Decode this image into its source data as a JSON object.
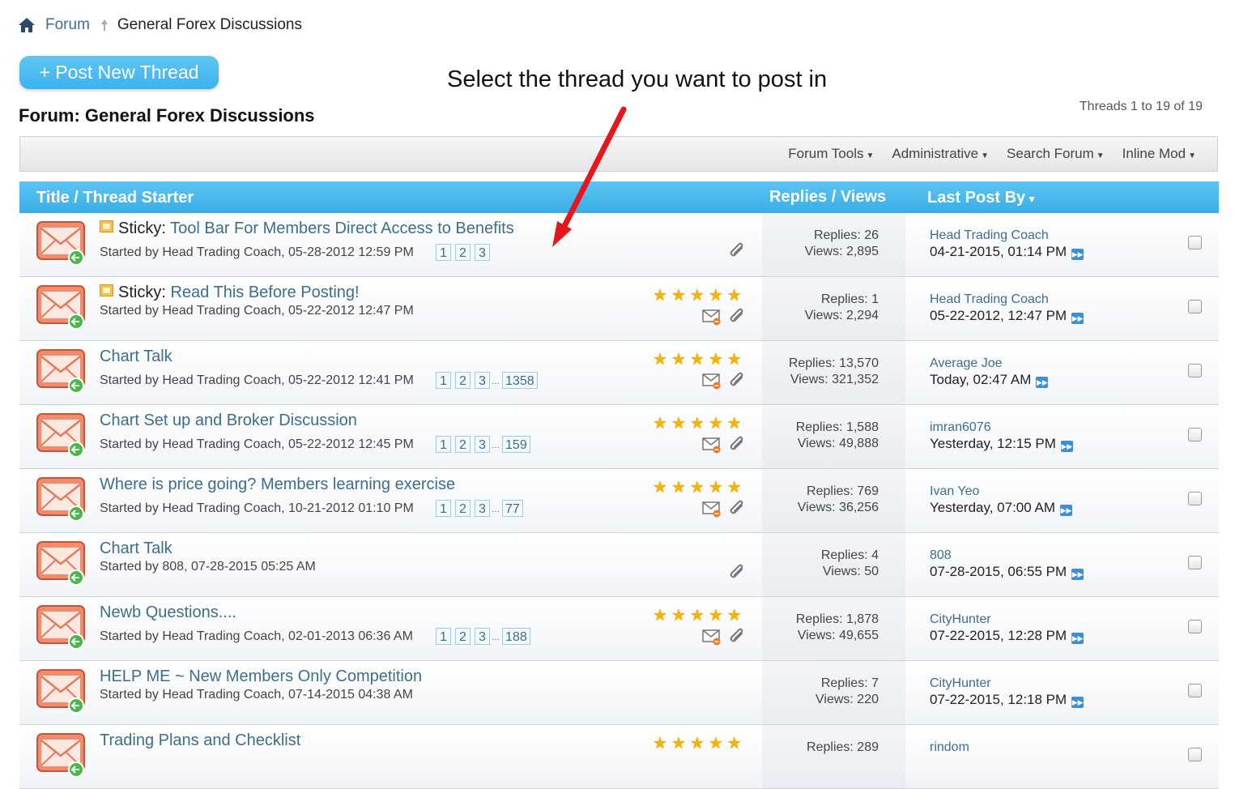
{
  "breadcrumb": {
    "home_icon": "home-icon",
    "forum": "Forum",
    "current": "General Forex Discussions"
  },
  "post_button": {
    "label": "+ Post New Thread"
  },
  "annotation": "Select the thread you want to post in",
  "forum_title": "Forum: General Forex Discussions",
  "thread_count": "Threads 1 to 19 of 19",
  "toolbar": {
    "items": [
      "Forum Tools",
      "Administrative",
      "Search Forum",
      "Inline Mod"
    ]
  },
  "table_header": {
    "title_col": "Title / Thread Starter",
    "stats_col": "Replies / Views",
    "lastpost_col": "Last Post By"
  },
  "colors": {
    "accent": "#3cb2ee",
    "link": "#3e6d8e",
    "star": "#f4b400",
    "arrow": "#e8161b"
  },
  "threads": [
    {
      "prefix": "Sticky:",
      "title": "Tool Bar For Members Direct Access to Benefits",
      "sticky": true,
      "starter": "Started by Head Trading Coach, 05-28-2012 12:59 PM",
      "pages": [
        "1",
        "2",
        "3"
      ],
      "last_page": "",
      "rating": 0,
      "mod_icon": false,
      "attachment": true,
      "replies": "Replies: 26",
      "views": "Views: 2,895",
      "last_user": "Head Trading Coach",
      "last_date": "04-21-2015, 01:14 PM"
    },
    {
      "prefix": "Sticky:",
      "title": "Read This Before Posting!",
      "sticky": true,
      "starter": "Started by Head Trading Coach, 05-22-2012 12:47 PM",
      "pages": [],
      "last_page": "",
      "rating": 5,
      "mod_icon": true,
      "attachment": true,
      "replies": "Replies: 1",
      "views": "Views: 2,294",
      "last_user": "Head Trading Coach",
      "last_date": "05-22-2012, 12:47 PM"
    },
    {
      "prefix": "",
      "title": "Chart Talk",
      "sticky": false,
      "starter": "Started by Head Trading Coach, 05-22-2012 12:41 PM",
      "pages": [
        "1",
        "2",
        "3"
      ],
      "last_page": "1358",
      "rating": 5,
      "mod_icon": true,
      "attachment": true,
      "replies": "Replies: 13,570",
      "views": "Views: 321,352",
      "last_user": "Average Joe",
      "last_date": "Today, 02:47 AM"
    },
    {
      "prefix": "",
      "title": "Chart Set up and Broker Discussion",
      "sticky": false,
      "starter": "Started by Head Trading Coach, 05-22-2012 12:45 PM",
      "pages": [
        "1",
        "2",
        "3"
      ],
      "last_page": "159",
      "rating": 5,
      "mod_icon": true,
      "attachment": true,
      "replies": "Replies: 1,588",
      "views": "Views: 49,888",
      "last_user": "imran6076",
      "last_date": "Yesterday, 12:15 PM"
    },
    {
      "prefix": "",
      "title": "Where is price going? Members learning exercise",
      "sticky": false,
      "starter": "Started by Head Trading Coach, 10-21-2012 01:10 PM",
      "pages": [
        "1",
        "2",
        "3"
      ],
      "last_page": "77",
      "rating": 5,
      "mod_icon": true,
      "attachment": true,
      "replies": "Replies: 769",
      "views": "Views: 36,256",
      "last_user": "Ivan Yeo",
      "last_date": "Yesterday, 07:00 AM"
    },
    {
      "prefix": "",
      "title": "Chart Talk",
      "sticky": false,
      "starter": "Started by 808, 07-28-2015 05:25 AM",
      "pages": [],
      "last_page": "",
      "rating": 0,
      "mod_icon": false,
      "attachment": true,
      "replies": "Replies: 4",
      "views": "Views: 50",
      "last_user": "808",
      "last_date": "07-28-2015, 06:55 PM"
    },
    {
      "prefix": "",
      "title": "Newb Questions....",
      "sticky": false,
      "starter": "Started by Head Trading Coach, 02-01-2013 06:36 AM",
      "pages": [
        "1",
        "2",
        "3"
      ],
      "last_page": "188",
      "rating": 5,
      "mod_icon": true,
      "attachment": true,
      "replies": "Replies: 1,878",
      "views": "Views: 49,655",
      "last_user": "CityHunter",
      "last_date": "07-22-2015, 12:28 PM"
    },
    {
      "prefix": "",
      "title": "HELP ME ~ New Members Only Competition",
      "sticky": false,
      "starter": "Started by Head Trading Coach, 07-14-2015 04:38 AM",
      "pages": [],
      "last_page": "",
      "rating": 0,
      "mod_icon": false,
      "attachment": false,
      "replies": "Replies: 7",
      "views": "Views: 220",
      "last_user": "CityHunter",
      "last_date": "07-22-2015, 12:18 PM"
    },
    {
      "prefix": "",
      "title": "Trading Plans and Checklist",
      "sticky": false,
      "starter": "",
      "pages": [],
      "last_page": "",
      "rating": 5,
      "mod_icon": false,
      "attachment": false,
      "replies": "Replies: 289",
      "views": "",
      "last_user": "rindom",
      "last_date": ""
    }
  ]
}
